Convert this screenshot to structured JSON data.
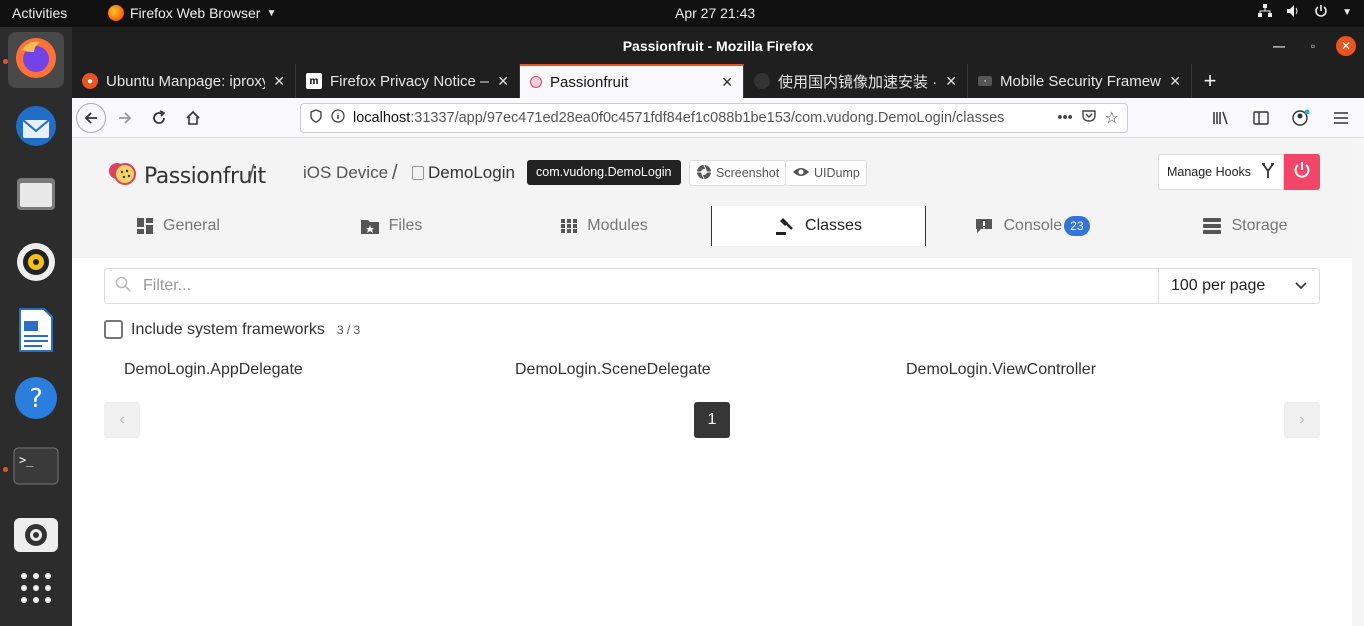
{
  "topbar": {
    "activities": "Activities",
    "app_name": "Firefox Web Browser",
    "clock": "Apr 27  21:43"
  },
  "dock": {
    "items": [
      "firefox",
      "thunderbird",
      "files",
      "rhythmbox",
      "libreoffice-writer",
      "help",
      "terminal",
      "screenshot",
      "show-applications"
    ]
  },
  "window": {
    "title": "Passionfruit - Mozilla Firefox"
  },
  "browser": {
    "tabs": [
      {
        "title": "Ubuntu Manpage: iproxy"
      },
      {
        "title": "Firefox Privacy Notice —"
      },
      {
        "title": "Passionfruit"
      },
      {
        "title": "使用国内镜像加速安装 · c"
      },
      {
        "title": "Mobile Security Framewo"
      }
    ],
    "url_host": "localhost",
    "url_path": ":31337/app/97ec471ed28ea0f0c4571fdf84ef1c088b1be153/com.vudong.DemoLogin/classes",
    "url_more": "•••"
  },
  "app": {
    "logo_text": "Passionfruit",
    "sep1": "/",
    "device": "iOS Device",
    "sep2": "/",
    "app_name": "DemoLogin",
    "bundle_id": "com.vudong.DemoLogin",
    "screenshot_label": "Screenshot",
    "uidump_label": "UIDump",
    "manage_hooks_label": "Manage Hooks",
    "tabs": [
      {
        "label": "General"
      },
      {
        "label": "Files"
      },
      {
        "label": "Modules"
      },
      {
        "label": "Classes"
      },
      {
        "label": "Console",
        "badge": "23"
      },
      {
        "label": "Storage"
      }
    ],
    "filter_placeholder": "Filter...",
    "per_page": "100 per page",
    "include_system_label": "Include system frameworks",
    "include_system_count": "3 / 3",
    "classes": [
      "DemoLogin.AppDelegate",
      "DemoLogin.SceneDelegate",
      "DemoLogin.ViewController"
    ],
    "current_page": "1",
    "prev": "‹",
    "next": "›"
  },
  "colors": {
    "accent": "#e95420",
    "danger": "#f14668",
    "info": "#3273dc"
  }
}
